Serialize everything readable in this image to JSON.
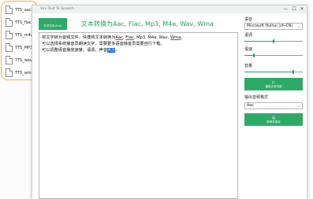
{
  "files": [
    {
      "label": "TTS_aac"
    },
    {
      "label": "TTS_flac"
    },
    {
      "label": "TTS_m4a"
    },
    {
      "label": "TTS_MP3"
    },
    {
      "label": "TTS_wav"
    },
    {
      "label": "TTS_wma"
    }
  ],
  "window": {
    "title": "Vov Text To Speech",
    "minimize": "—",
    "maximize": "☐",
    "close": "✕"
  },
  "toolbar": {
    "open_button_label": "打开文本(Ctrl)",
    "heading": "文本转换为Aac, Flac, Mp3, M4a, Wav, Wma"
  },
  "editor": {
    "line1_a": "将文字转为音频文件，快捷将文本转换为",
    "line1_aac": "Aac",
    "line1_sep1": ", ",
    "line1_flac": "Flac",
    "line1_mid": ", Mp3, M4a, Wav, ",
    "line1_wma": "Wma",
    "line1_end": "。",
    "line2": "可以选择系统播音员朗读文字，需要更多语音播音员需要自行下载。",
    "line3_a": "可以调整语音播放速度、语调、声音",
    "line3_selected": "大小",
    "line3_end": "。"
  },
  "settings": {
    "voice_label": "语音",
    "voice_value": "Microsoft Huihui (zh-CN)",
    "pitch_label": "语调",
    "pitch_level": 0.5,
    "rate_label": "语速",
    "rate_level": 0.16,
    "volume_label": "音量",
    "volume_level": 0.84,
    "play_button_label": "播放文本内容",
    "format_label": "输出音频格式",
    "format_value": "Aac",
    "convert_button_label": "转换并保存"
  },
  "colors": {
    "accent": "#2eaa68",
    "heading": "#27a05e",
    "selection": "#1a6fd6",
    "file_panel_border": "#f0b84c"
  }
}
